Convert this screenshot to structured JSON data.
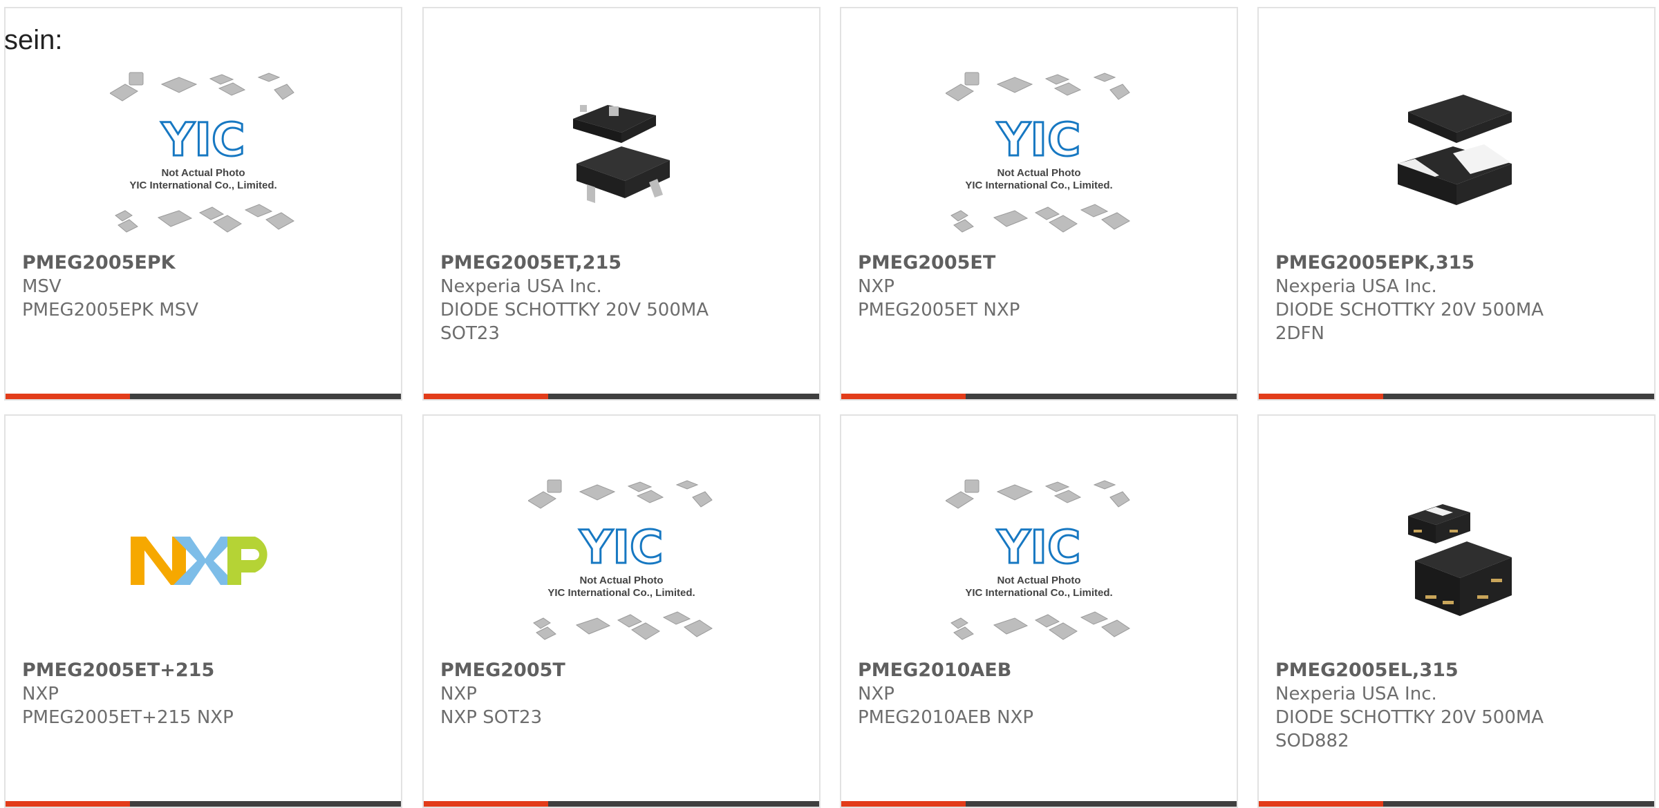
{
  "intro": {
    "text": "sein:"
  },
  "placeholder": {
    "line1": "Not Actual Photo",
    "line2": "YIC International Co., Limited.",
    "logo": "YIC"
  },
  "brand_logo": {
    "text": "NXP",
    "colors": [
      "#f6a800",
      "#7dbde8",
      "#b5d335"
    ]
  },
  "colors": {
    "accent": "#e23c1a",
    "bar_dark": "#3f3f3f",
    "card_border": "#e2e2e2",
    "text_dark": "#5f5f5f",
    "text": "#6d6d6d"
  },
  "products": [
    {
      "part": "PMEG2005EPK",
      "manufacturer": "MSV",
      "description": "PMEG2005EPK MSV",
      "image": "placeholder"
    },
    {
      "part": "PMEG2005ET,215",
      "manufacturer": "Nexperia USA Inc.",
      "description": "DIODE SCHOTTKY 20V 500MA\nSOT23",
      "image": "sot23-package"
    },
    {
      "part": "PMEG2005ET",
      "manufacturer": "NXP",
      "description": "PMEG2005ET NXP",
      "image": "placeholder"
    },
    {
      "part": "PMEG2005EPK,315",
      "manufacturer": "Nexperia USA Inc.",
      "description": "DIODE SCHOTTKY 20V 500MA\n2DFN",
      "image": "dfn-package"
    },
    {
      "part": "PMEG2005ET+215",
      "manufacturer": "NXP",
      "description": "PMEG2005ET+215 NXP",
      "image": "nxp-logo"
    },
    {
      "part": "PMEG2005T",
      "manufacturer": "NXP",
      "description": "NXP SOT23",
      "image": "placeholder"
    },
    {
      "part": "PMEG2010AEB",
      "manufacturer": "NXP",
      "description": "PMEG2010AEB NXP",
      "image": "placeholder"
    },
    {
      "part": "PMEG2005EL,315",
      "manufacturer": "Nexperia USA Inc.",
      "description": "DIODE SCHOTTKY 20V 500MA\nSOD882",
      "image": "sod882-package"
    }
  ]
}
